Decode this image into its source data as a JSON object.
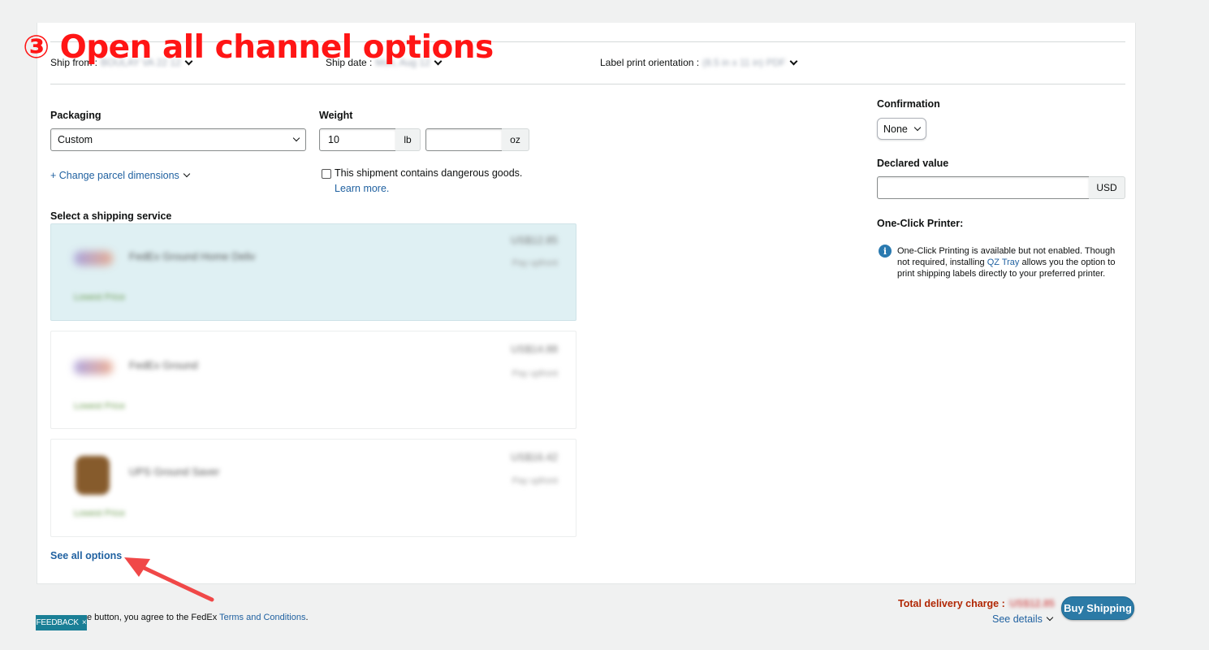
{
  "annotation": {
    "text": "③ Open all channel options"
  },
  "top_row": {
    "ship_from_label": "Ship from :",
    "ship_from_value": "BOULAY VA 22 12",
    "ship_date_label": "Ship date :",
    "ship_date_value": "Mon, Aug 12",
    "orientation_label": "Label print orientation :",
    "orientation_value": "(8.5 in x 11 in) PDF"
  },
  "packaging": {
    "label": "Packaging",
    "value": "Custom",
    "change_link": "+ Change parcel dimensions"
  },
  "weight": {
    "label": "Weight",
    "lb_value": "10",
    "lb_unit": "lb",
    "oz_value": "",
    "oz_unit": "oz"
  },
  "dangerous": {
    "text": "This shipment contains dangerous goods.",
    "learn_more": "Learn more."
  },
  "shipping": {
    "label": "Select a shipping service",
    "services": [
      {
        "name": "FedEx Ground Home Deliv",
        "price": "US$12.85",
        "sub": "Pay upfront",
        "badge": "Lowest Price"
      },
      {
        "name": "FedEx Ground",
        "price": "US$14.88",
        "sub": "Pay upfront",
        "badge": "Lowest Price"
      },
      {
        "name": "UPS Ground Saver",
        "price": "US$16.42",
        "sub": "Pay upfront",
        "badge": "Lowest Price"
      }
    ],
    "see_all": "See all options"
  },
  "confirmation": {
    "label": "Confirmation",
    "value": "None"
  },
  "declared_value": {
    "label": "Declared value",
    "value": "",
    "currency": "USD"
  },
  "printer": {
    "label": "One-Click Printer:",
    "info_before": "One-Click Printing is available but not enabled. Though not required, installing ",
    "info_link": "QZ Tray",
    "info_after": " allows you the option to print shipping labels directly to your preferred printer."
  },
  "footer": {
    "terms_prefix": "e button, you agree to the FedEx ",
    "terms_link": "Terms and Conditions",
    "terms_suffix": ".",
    "feedback": "FEEDBACK",
    "total_label": "Total delivery charge :",
    "total_value": "US$12.85",
    "buy_button": "Buy Shipping",
    "see_details": "See details"
  },
  "colors": {
    "annotation": "#ff1515",
    "link": "#2162a1",
    "selected_service": "#dff0f3",
    "buy_button": "#2b7aa6",
    "total_label": "#b12704"
  }
}
